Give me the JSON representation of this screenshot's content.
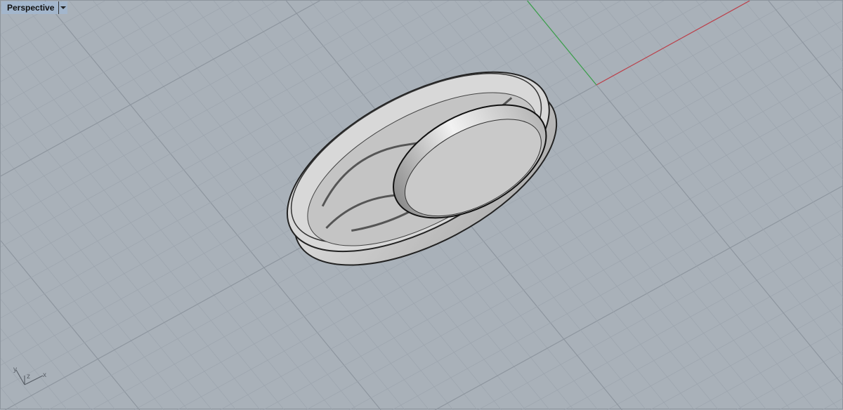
{
  "viewport": {
    "title": "Perspective",
    "axis_labels": {
      "x": "x",
      "y": "y",
      "z": "z"
    }
  },
  "colors": {
    "background": "#a9b1b9",
    "grid_minor": "#9ea6af",
    "grid_major": "#8e969f",
    "x_axis": "#c0404a",
    "y_axis": "#3aa04a",
    "tab": "#a3b6cc"
  }
}
